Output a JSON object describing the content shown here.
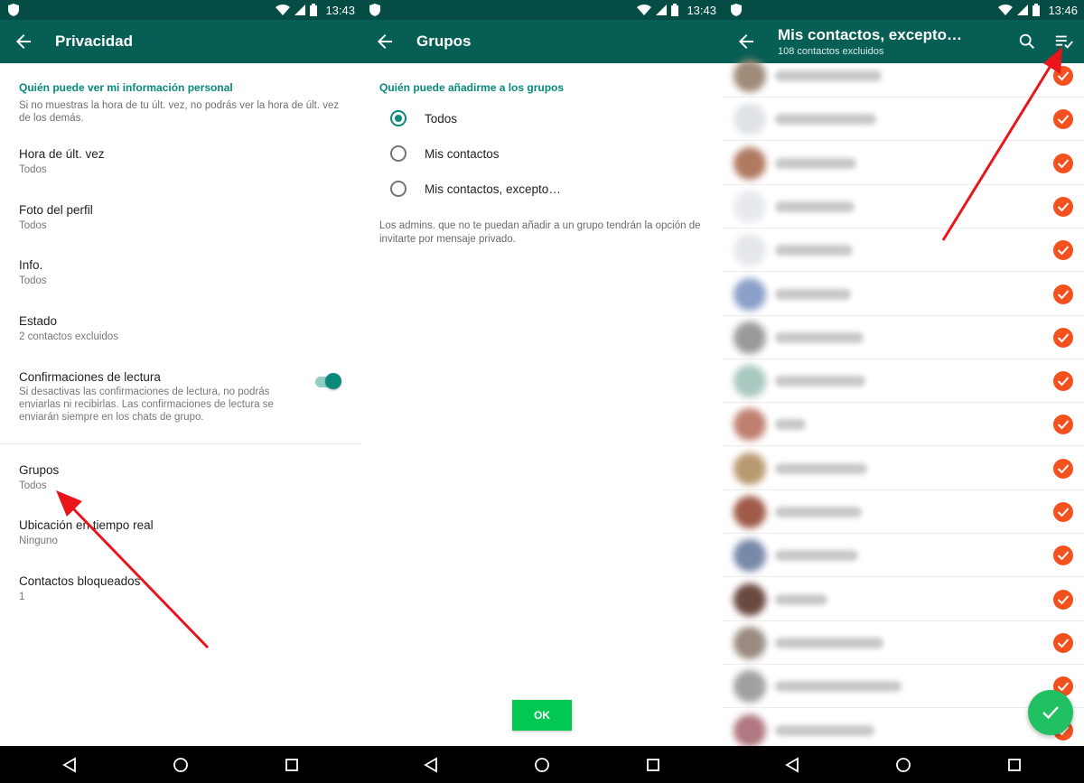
{
  "colors": {
    "status_bar": "#054d44",
    "app_bar": "#075e54",
    "accent_teal": "#07897a",
    "check_orange": "#f4511e",
    "ok_green": "#00c853",
    "fab_green": "#21c063",
    "arrow_red": "#e8161b"
  },
  "status": {
    "time1": "13:43",
    "time2": "13:43",
    "time3": "13:46"
  },
  "privacy": {
    "title": "Privacidad",
    "section_header": "Quién puede ver mi información personal",
    "section_desc": "Si no muestras la hora de tu últ. vez, no podrás ver la hora de últ. vez de los demás.",
    "items": [
      {
        "title": "Hora de últ. vez",
        "value": "Todos"
      },
      {
        "title": "Foto del perfil",
        "value": "Todos"
      },
      {
        "title": "Info.",
        "value": "Todos"
      },
      {
        "title": "Estado",
        "value": "2 contactos excluidos"
      }
    ],
    "read_receipts": {
      "title": "Confirmaciones de lectura",
      "desc": "Si desactivas las confirmaciones de lectura, no podrás enviarlas ni recibirlas. Las confirmaciones de lectura se enviarán siempre en los chats de grupo.",
      "enabled": true
    },
    "items2": [
      {
        "title": "Grupos",
        "value": "Todos"
      },
      {
        "title": "Ubicación en tiempo real",
        "value": "Ninguno"
      },
      {
        "title": "Contactos bloqueados",
        "value": "1"
      }
    ]
  },
  "groups": {
    "title": "Grupos",
    "header": "Quién puede añadirme a los grupos",
    "options": [
      {
        "label": "Todos",
        "selected": true
      },
      {
        "label": "Mis contactos",
        "selected": false
      },
      {
        "label": "Mis contactos, excepto…",
        "selected": false
      }
    ],
    "note": "Los admins. que no te puedan añadir a un grupo tendrán la opción de invitarte por mensaje privado.",
    "ok_label": "OK"
  },
  "except": {
    "title": "Mis contactos, excepto…",
    "subtitle": "108 contactos excluidos",
    "contacts_all_checked": true
  },
  "icons": {
    "back": "arrow-back-icon",
    "search": "search-icon",
    "select_all": "select-all-icon",
    "check": "check-icon",
    "nav_back": "triangle-back-icon",
    "nav_home": "circle-home-icon",
    "nav_recents": "square-recents-icon"
  }
}
